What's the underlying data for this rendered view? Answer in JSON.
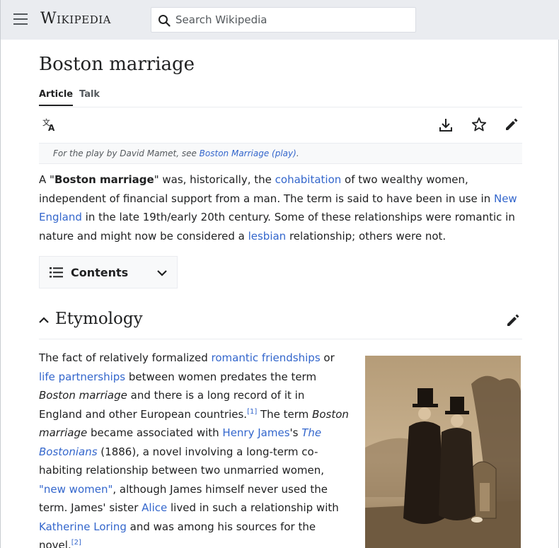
{
  "header": {
    "wordmark": "Wikipedia",
    "search_placeholder": "Search Wikipedia"
  },
  "page": {
    "title": "Boston marriage",
    "tabs": [
      {
        "label": "Article",
        "active": true
      },
      {
        "label": "Talk",
        "active": false
      }
    ]
  },
  "hatnote": {
    "prefix": "For the play by David Mamet, see ",
    "link": "Boston Marriage (play)",
    "suffix": "."
  },
  "intro": {
    "t1": "A \"",
    "bold": "Boston marriage",
    "t2": "\" was, historically, the ",
    "l1": "cohabitation",
    "t3": " of two wealthy women, independent of financial support from a man. The term is said to have been in use in ",
    "l2": "New England",
    "t4": " in the late 19th/early 20th century. Some of these relationships were romantic in nature and might now be considered a ",
    "l3": "lesbian",
    "t5": " relationship; others were not."
  },
  "contents": {
    "label": "Contents"
  },
  "section": {
    "title": "Etymology"
  },
  "etymology": {
    "t1": "The fact of relatively formalized ",
    "l1": "romantic friendships",
    "t2": " or ",
    "l2": "life partnerships",
    "t3": " between women predates the term ",
    "i1": "Boston marriage",
    "t4": " and there is a long record of it in England and other European countries.",
    "ref1": "[1]",
    "t5": " The term ",
    "i2": "Boston marriage",
    "t6": " became associated with ",
    "l3": "Henry James",
    "t7": "'s ",
    "l4": "The Bostonians",
    "t8": " (1886), a novel involving a long-term co-habiting relationship between two unmarried women, ",
    "l5": "\"new women\"",
    "t9": ", although James himself never used the term. James' sister ",
    "l6": "Alice",
    "t10": " lived in such a relationship with ",
    "l7": "Katherine Loring",
    "t11": " and was among his sources for the novel.",
    "ref2": "[2]"
  },
  "icons": [
    "menu-icon",
    "search-icon",
    "language-icon",
    "download-icon",
    "star-icon",
    "edit-icon",
    "list-icon",
    "chevron-down-icon",
    "chevron-up-icon"
  ],
  "colors": {
    "link": "#3366cc",
    "header_bg": "#eaecf0",
    "text": "#202122"
  }
}
